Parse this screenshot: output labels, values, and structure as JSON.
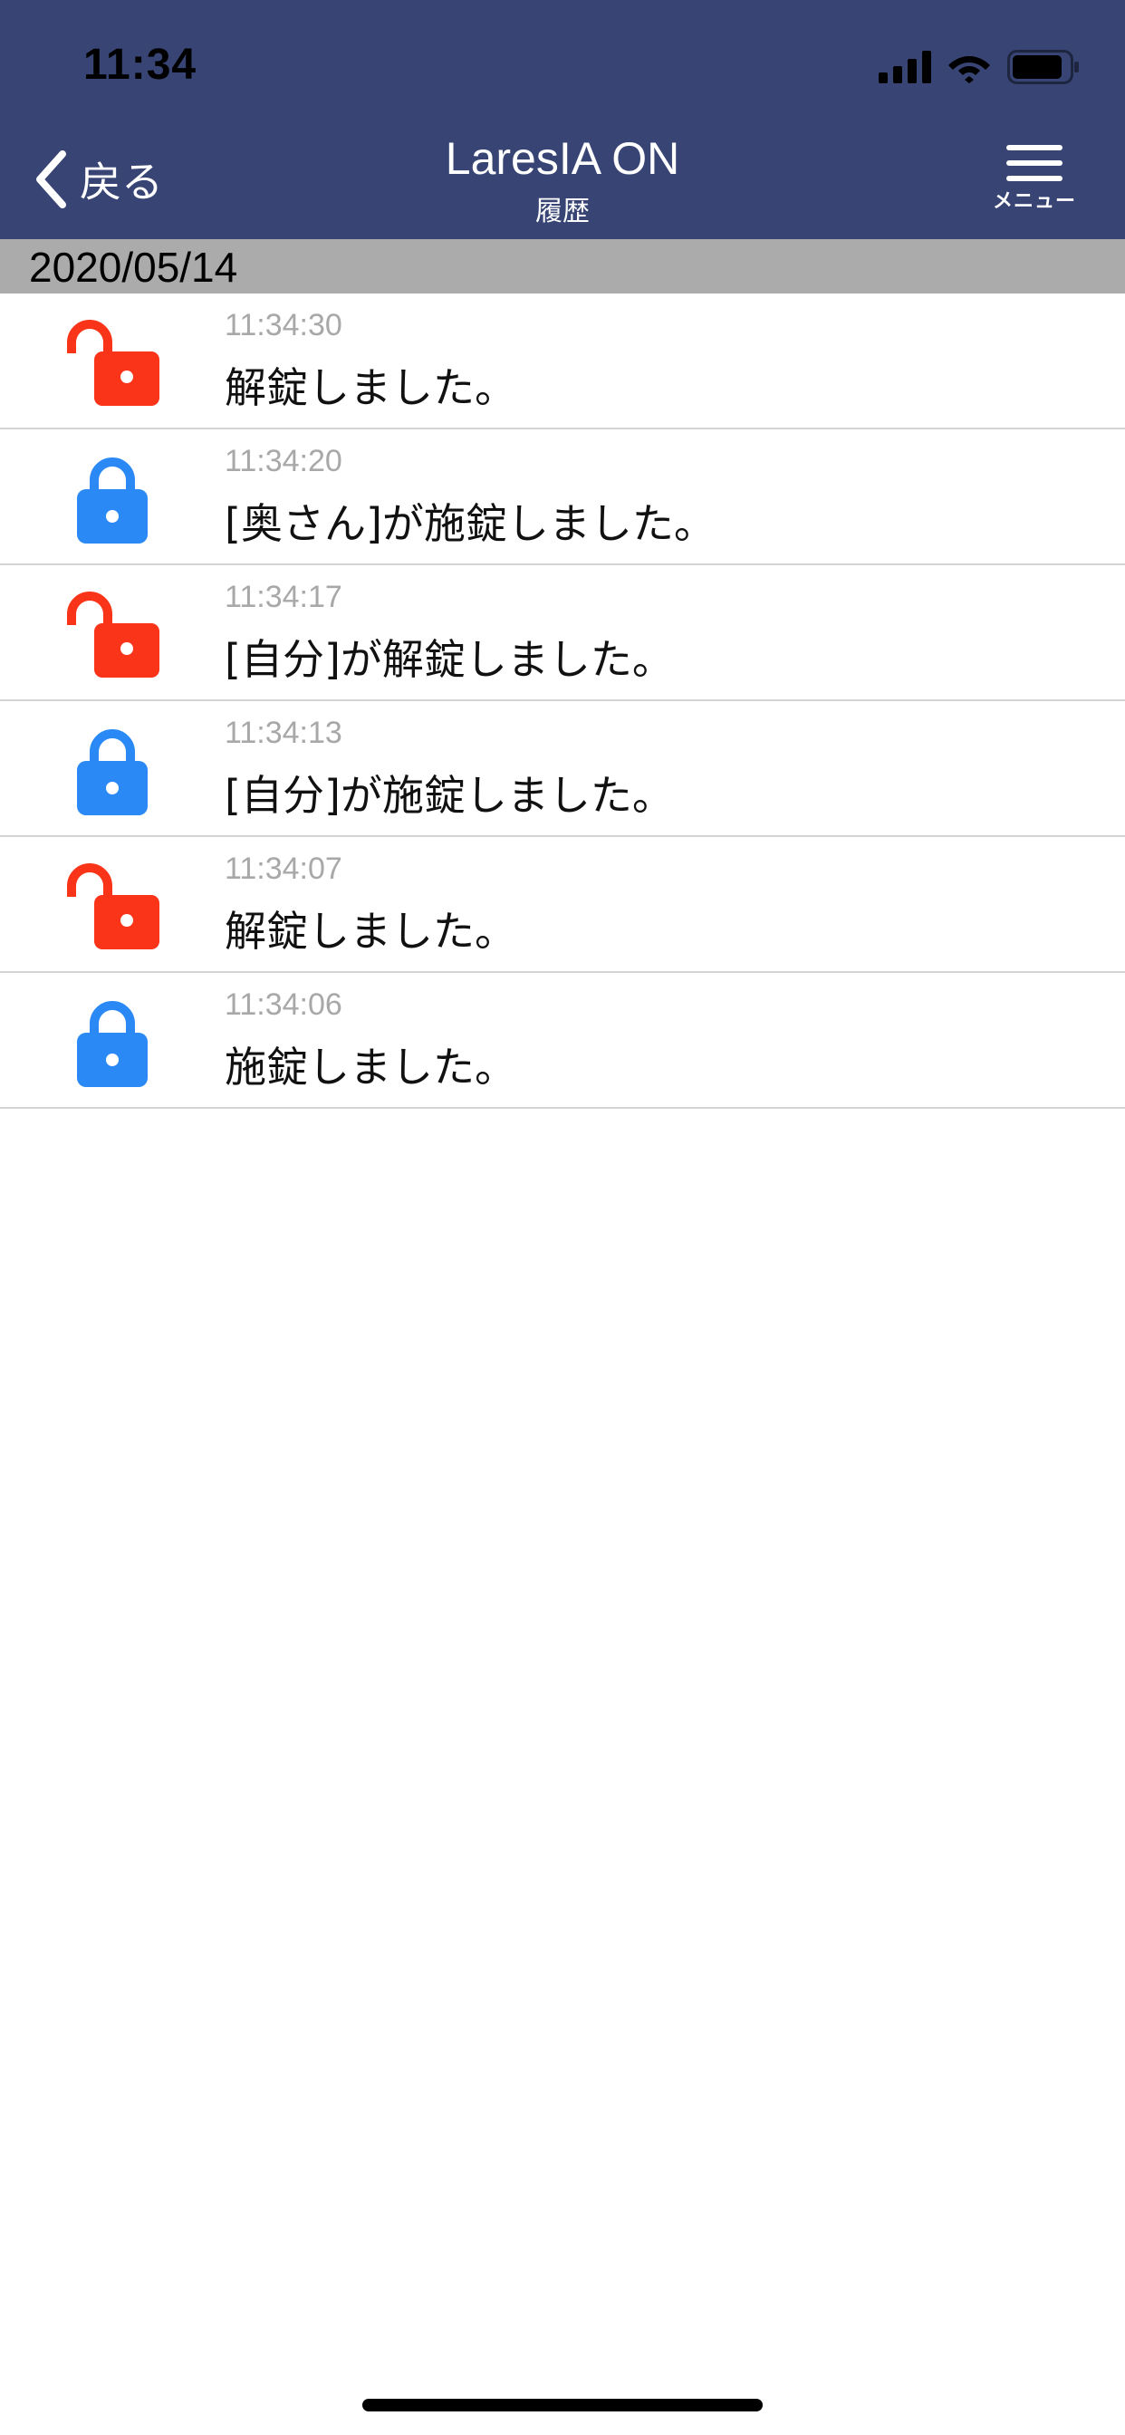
{
  "status_bar": {
    "time": "11:34",
    "icons": [
      "cellular-signal-icon",
      "wifi-icon",
      "battery-icon"
    ]
  },
  "nav": {
    "back_label": "戻る",
    "title": "LaresIA ON",
    "subtitle": "履歴",
    "menu_label": "メニュー",
    "icons": {
      "back": "chevron-left-icon",
      "menu": "hamburger-menu-icon"
    },
    "background_color": "#374474"
  },
  "history": {
    "date": "2020/05/14",
    "entries": [
      {
        "time": "11:34:30",
        "message": "解錠しました。",
        "state": "unlocked",
        "icon": "lock-open-icon",
        "color": "#fa3419"
      },
      {
        "time": "11:34:20",
        "message": "[奥さん]が施錠しました。",
        "state": "locked",
        "icon": "lock-closed-icon",
        "color": "#2a89f5"
      },
      {
        "time": "11:34:17",
        "message": "[自分]が解錠しました。",
        "state": "unlocked",
        "icon": "lock-open-icon",
        "color": "#fa3419"
      },
      {
        "time": "11:34:13",
        "message": "[自分]が施錠しました。",
        "state": "locked",
        "icon": "lock-closed-icon",
        "color": "#2a89f5"
      },
      {
        "time": "11:34:07",
        "message": "解錠しました。",
        "state": "unlocked",
        "icon": "lock-open-icon",
        "color": "#fa3419"
      },
      {
        "time": "11:34:06",
        "message": "施錠しました。",
        "state": "locked",
        "icon": "lock-closed-icon",
        "color": "#2a89f5"
      }
    ]
  }
}
